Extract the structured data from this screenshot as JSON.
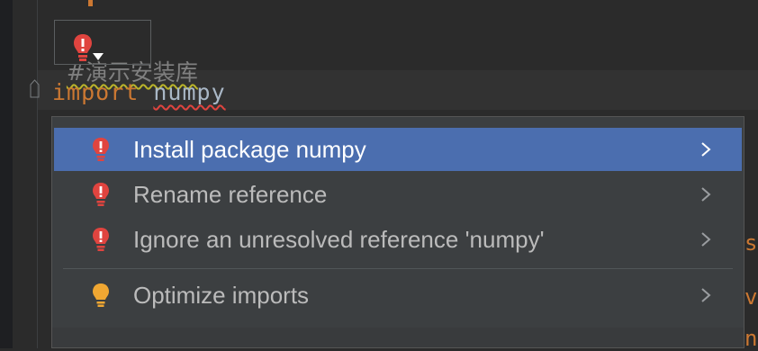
{
  "editor": {
    "comment_text": "#演示安装库",
    "import_keyword": "import",
    "import_module": "numpy",
    "right_hints": [
      "s",
      "v",
      "n"
    ]
  },
  "intention_menu": {
    "items": [
      {
        "label": "Install package numpy",
        "icon": "red-error-bulb-icon",
        "selected": true
      },
      {
        "label": "Rename reference",
        "icon": "red-error-bulb-icon",
        "selected": false
      },
      {
        "label": "Ignore an unresolved reference 'numpy'",
        "icon": "red-error-bulb-icon",
        "selected": false
      },
      {
        "label": "Optimize imports",
        "icon": "yellow-bulb-icon",
        "selected": false
      }
    ]
  },
  "colors": {
    "background": "#2b2b2b",
    "keyword": "#cc7832",
    "selection": "#4b6eaf",
    "error_bulb": "#e0443f",
    "intention_bulb": "#f0a732"
  }
}
